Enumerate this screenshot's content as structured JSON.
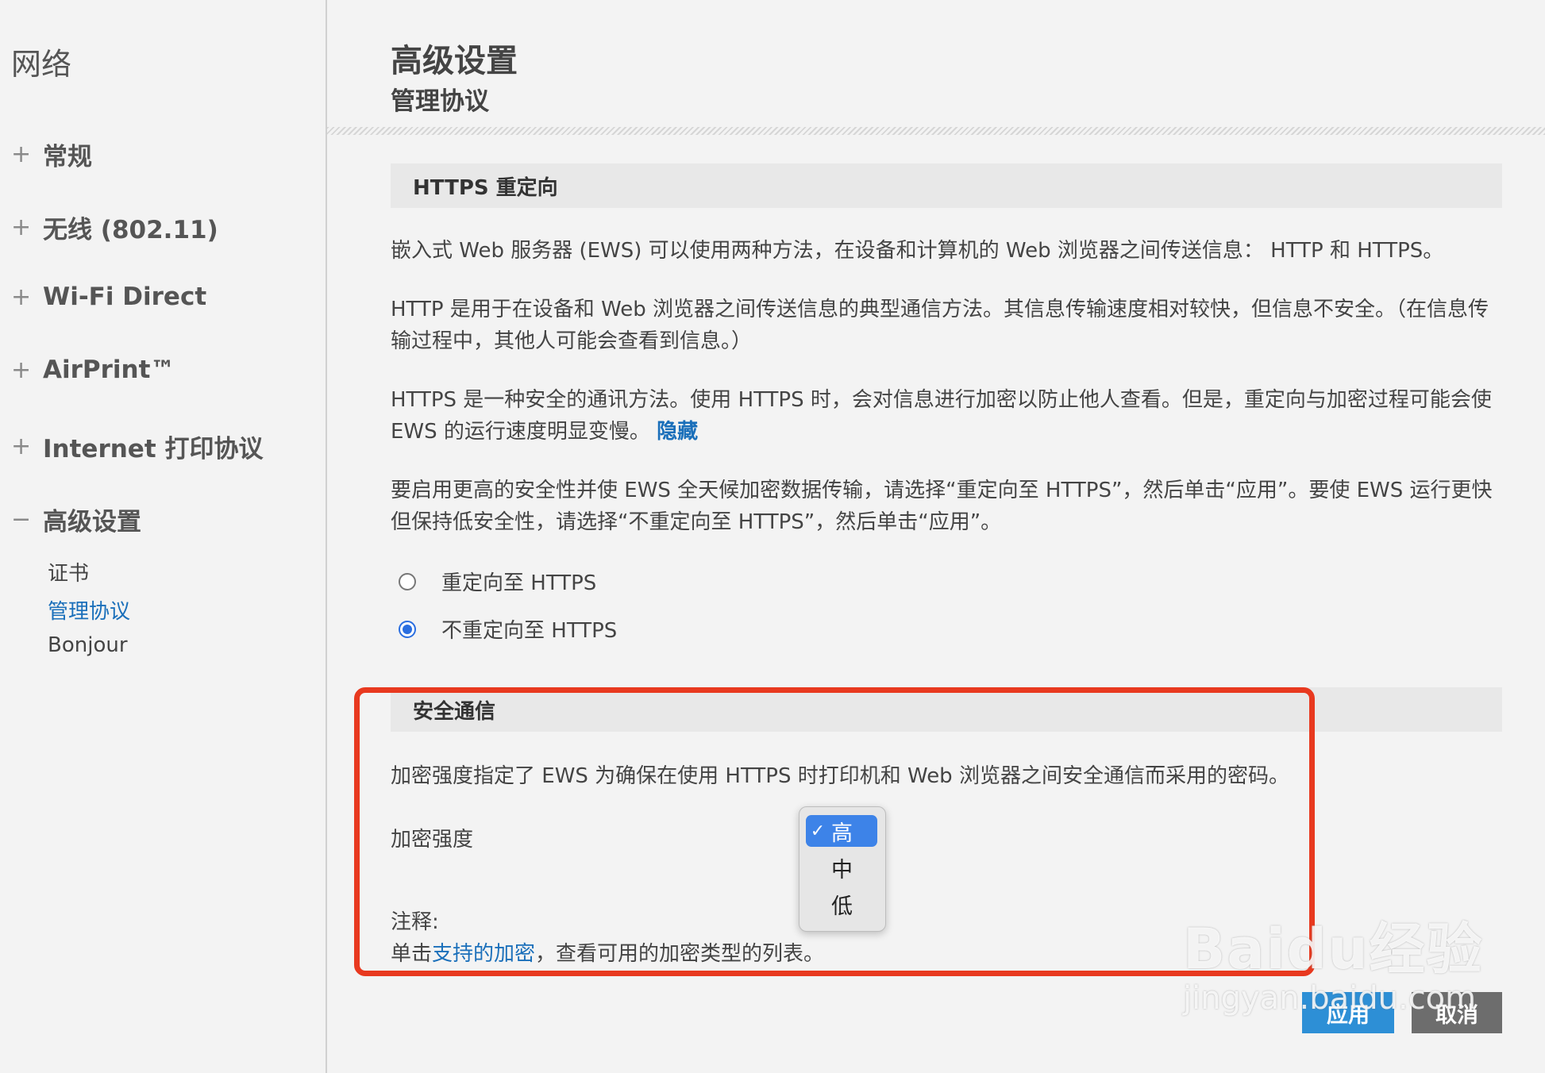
{
  "sidebar": {
    "title": "网络",
    "items": [
      {
        "sign": "+",
        "label": "常规"
      },
      {
        "sign": "+",
        "label": "无线 (802.11)"
      },
      {
        "sign": "+",
        "label": "Wi-Fi Direct"
      },
      {
        "sign": "+",
        "label": "AirPrint™"
      },
      {
        "sign": "+",
        "label": "Internet 打印协议"
      },
      {
        "sign": "−",
        "label": "高级设置"
      }
    ],
    "subitems": [
      {
        "label": "证书",
        "active": false
      },
      {
        "label": "管理协议",
        "active": true
      },
      {
        "label": "Bonjour",
        "active": false
      }
    ]
  },
  "header": {
    "title": "高级设置",
    "subtitle": "管理协议"
  },
  "https_section": {
    "title": "HTTPS 重定向",
    "p1": "嵌入式 Web 服务器 (EWS) 可以使用两种方法，在设备和计算机的 Web 浏览器之间传送信息： HTTP 和 HTTPS。",
    "p2": "HTTP 是用于在设备和 Web 浏览器之间传送信息的典型通信方法。其信息传输速度相对较快，但信息不安全。（在信息传输过程中，其他人可能会查看到信息。）",
    "p3_text": "HTTPS 是一种安全的通讯方法。使用 HTTPS 时，会对信息进行加密以防止他人查看。但是，重定向与加密过程可能会使 EWS 的运行速度明显变慢。",
    "p3_link": "隐藏",
    "p4": "要启用更高的安全性并使 EWS 全天候加密数据传输，请选择“重定向至 HTTPS”，然后单击“应用”。要使 EWS 运行更快但保持低安全性，请选择“不重定向至 HTTPS”，然后单击“应用”。",
    "options": [
      {
        "label": "重定向至 HTTPS",
        "checked": false
      },
      {
        "label": "不重定向至 HTTPS",
        "checked": true
      }
    ]
  },
  "secure_section": {
    "title": "安全通信",
    "desc": "加密强度指定了 EWS 为确保在使用 HTTPS 时打印机和 Web 浏览器之间安全通信而采用的密码。",
    "strength_label": "加密强度",
    "note_label": "注释:",
    "note_prefix": "单击",
    "note_link": "支持的加密",
    "note_suffix": "，查看可用的加密类型的列表。",
    "dropdown": {
      "options": [
        "高",
        "中",
        "低"
      ],
      "selected": "高",
      "check": "✓"
    }
  },
  "buttons": {
    "apply": "应用",
    "cancel": "取消"
  },
  "watermark": {
    "logo": "Baidu经验",
    "url": "jingyan.baidu.com"
  },
  "colors": {
    "link": "#1a6fba",
    "radio_selected": "#2a6ee0",
    "highlight": "#e8391f",
    "apply_button": "#2d8fd6",
    "cancel_button": "#6d6d6d"
  }
}
